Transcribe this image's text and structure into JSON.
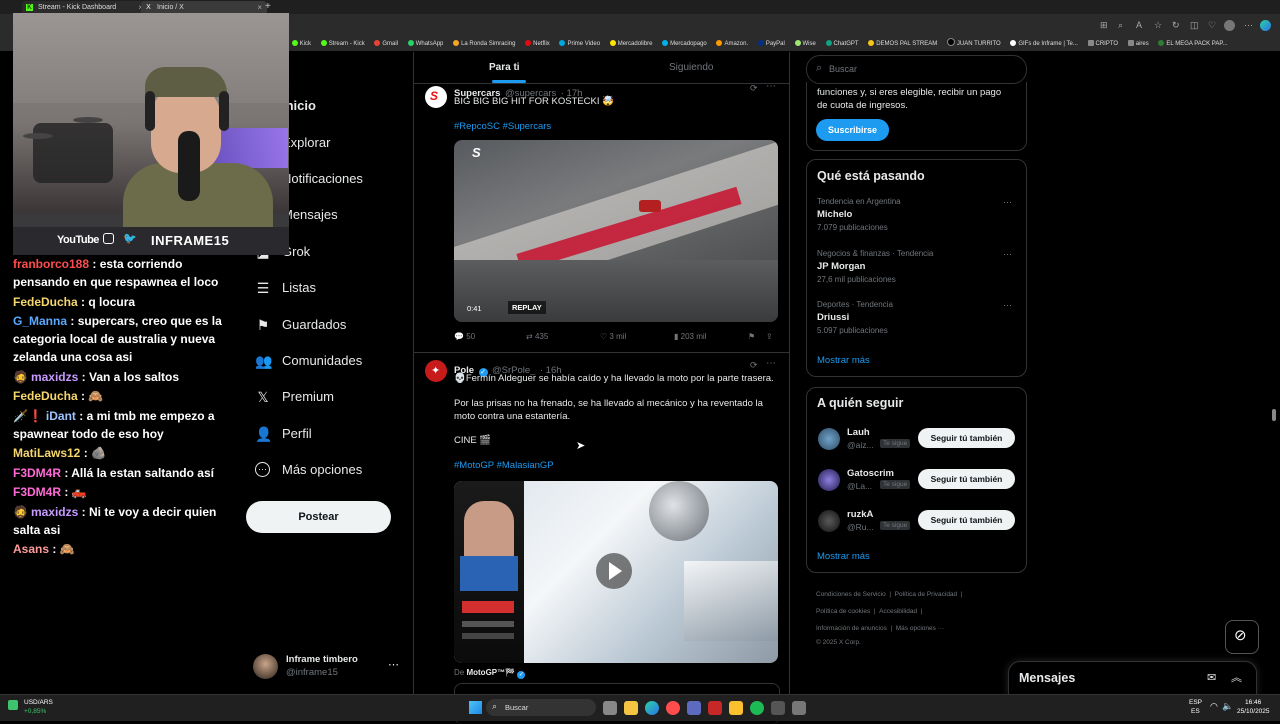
{
  "browser": {
    "tabs": [
      {
        "title": "Stream - Kick Dashboard",
        "icon": "K"
      },
      {
        "title": "Inicio / X",
        "icon": "X"
      }
    ],
    "new_tab": "+",
    "bookmarks": [
      "Kick",
      "Stream - Kick",
      "Gmail",
      "WhatsApp",
      "La Ronda Simracing",
      "Netflix",
      "Prime Video",
      "Mercadolibre",
      "Mercadopago",
      "Amazon.",
      "PayPal",
      "Wise",
      "ChatGPT",
      "DEMOS PAL STREAM",
      "JUAN TURRITO",
      "GIFs de Inframe | Te...",
      "CRIPTO",
      "aires",
      "EL MEGA PACK PAP..."
    ],
    "bookmark_colors": [
      "#53fc18",
      "#53fc18",
      "#ea4335",
      "#25d366",
      "#f5a623",
      "#e50914",
      "#00a8e1",
      "#ffe600",
      "#00b1ea",
      "#ff9900",
      "#003087",
      "#9fe870",
      "#10a37f",
      "#f5c518",
      "#000000",
      "#ffffff",
      "#888888",
      "#888888",
      "#2e7d32"
    ]
  },
  "webcam": {
    "youtube": "YouTube",
    "handle": "INFRAME15"
  },
  "chat": [
    {
      "user": "franborco188",
      "color": "#ff4d4d",
      "text": "esta corriendo pensando en que respawnea el loco",
      "badges": ""
    },
    {
      "user": "FedeDucha",
      "color": "#f5d76e",
      "text": "q locura",
      "badges": ""
    },
    {
      "user": "G_Manna",
      "color": "#5aa9ff",
      "text": "supercars, creo que es la categoria local de australia y nueva zelanda una cosa asi",
      "badges": ""
    },
    {
      "user": "maxidzs",
      "color": "#c79bff",
      "text": "Van a los saltos",
      "badges": "🧔"
    },
    {
      "user": "FedeDucha",
      "color": "#f5d76e",
      "text": "🙈",
      "badges": ""
    },
    {
      "user": "iDant",
      "color": "#9ec3ff",
      "text": "a mi tmb me empezo a spawnear todo de eso hoy",
      "badges": "🗡️❗"
    },
    {
      "user": "MatiLaws12",
      "color": "#f5d76e",
      "text": "🪨",
      "badges": ""
    },
    {
      "user": "F3DM4R",
      "color": "#ff6bd6",
      "text": "Allá la estan saltando así",
      "badges": ""
    },
    {
      "user": "F3DM4R",
      "color": "#ff6bd6",
      "text": "🛻",
      "badges": ""
    },
    {
      "user": "maxidzs",
      "color": "#c79bff",
      "text": "Ni te voy a decir quien salta asi",
      "badges": "🧔"
    },
    {
      "user": "Asans",
      "color": "#ff9b9b",
      "text": "🙈",
      "badges": ""
    }
  ],
  "nav": {
    "items": [
      {
        "label": "Inicio",
        "icon": "home-icon",
        "glyph": "⌂"
      },
      {
        "label": "Explorar",
        "icon": "search-icon",
        "glyph": "⌕"
      },
      {
        "label": "Notificaciones",
        "icon": "bell-icon",
        "glyph": "🔔"
      },
      {
        "label": "Mensajes",
        "icon": "mail-icon",
        "glyph": "✉"
      },
      {
        "label": "Grok",
        "icon": "grok-icon",
        "glyph": "◪"
      },
      {
        "label": "Listas",
        "icon": "list-icon",
        "glyph": "☰"
      },
      {
        "label": "Guardados",
        "icon": "bookmark-icon",
        "glyph": "🔖"
      },
      {
        "label": "Comunidades",
        "icon": "people-icon",
        "glyph": "👥"
      },
      {
        "label": "Premium",
        "icon": "x-logo-icon",
        "glyph": "𝕏"
      },
      {
        "label": "Perfil",
        "icon": "person-icon",
        "glyph": "👤"
      },
      {
        "label": "Más opciones",
        "icon": "more-circle-icon",
        "glyph": "⋯"
      }
    ],
    "post_button": "Postear",
    "account_name": "Inframe timbero",
    "account_handle": "@inframe15"
  },
  "timeline": {
    "tabs": [
      "Para ti",
      "Siguiendo"
    ],
    "tweets": [
      {
        "name": "Supercars",
        "handle": "@supercars",
        "time": "· 17h",
        "text": "BIG BIG BIG HIT FOR KOSTECKI 🤯",
        "hashtags": "#RepcoSC #Supercars",
        "video_time": "0:41",
        "replay": "REPLAY",
        "replies": "50",
        "retweets": "435",
        "likes": "3 mil",
        "views": "203 mil"
      },
      {
        "name": "Pole",
        "handle": "@SrPole_",
        "time": "· 16h",
        "line1": "💀Fermín Aldeguer se había caído y ha llevado la moto por la parte trasera.",
        "line2": "Por las prisas no ha frenado, se ha llevado al mecánico y ha reventado la moto contra una estantería.",
        "line3": "CINE 🎬",
        "hashtags": "#MotoGP #MalasianGP",
        "from_label": "De",
        "from_name": "MotoGP™🏁"
      }
    ]
  },
  "right": {
    "search_placeholder": "Buscar",
    "premium_text_1": "funciones y, si eres elegible, recibir un pago",
    "premium_text_2": "de cuota de ingresos.",
    "subscribe": "Suscribirse",
    "trends_title": "Qué está pasando",
    "trends": [
      {
        "context": "Tendencia en Argentina",
        "title": "Michelo",
        "posts": "7.079 publicaciones"
      },
      {
        "context": "Negocios & finanzas · Tendencia",
        "title": "JP Morgan",
        "posts": "27,6 mil publicaciones"
      },
      {
        "context": "Deportes · Tendencia",
        "title": "Driussi",
        "posts": "5.097 publicaciones"
      }
    ],
    "show_more": "Mostrar más",
    "follow_title": "A quién seguir",
    "follow": [
      {
        "name": "Lauh",
        "handle": "@aiz...",
        "badge": "Te sigue",
        "button": "Seguir tú también"
      },
      {
        "name": "Gatoscrim",
        "handle": "@La...",
        "badge": "Te sigue",
        "button": "Seguir tú también"
      },
      {
        "name": "ruzkA",
        "handle": "@Ru...",
        "badge": "Te sigue",
        "button": "Seguir tú también"
      }
    ],
    "footer": {
      "l1a": "Condiciones de Servicio",
      "l1b": "Política de Privacidad",
      "l2a": "Política de cookies",
      "l2b": "Accesibilidad",
      "l3a": "Información de anuncios",
      "l3b": "Más opciones ···",
      "copyright": "© 2025 X Corp."
    },
    "messages": "Mensajes"
  },
  "taskbar": {
    "ticker_name": "USD/ARS",
    "ticker_change": "+0,85%",
    "search": "Buscar",
    "lang": "ESP",
    "lang2": "ES",
    "time": "16:46",
    "date": "25/10/2025"
  }
}
